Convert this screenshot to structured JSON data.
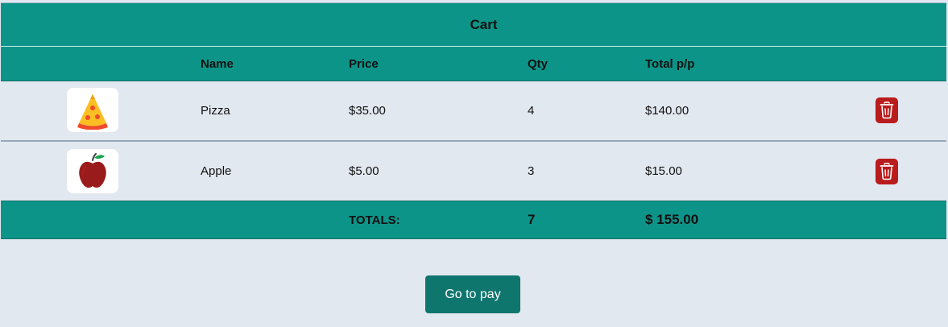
{
  "cart": {
    "title": "Cart",
    "columns": {
      "name": "Name",
      "price": "Price",
      "qty": "Qty",
      "total": "Total p/p"
    },
    "items": [
      {
        "name": "Pizza",
        "price": "$35.00",
        "qty": "4",
        "total": "$140.00",
        "icon": "pizza-icon"
      },
      {
        "name": "Apple",
        "price": "$5.00",
        "qty": "3",
        "total": "$15.00",
        "icon": "apple-icon"
      }
    ],
    "totals": {
      "label": "TOTALS:",
      "qty": "7",
      "amount": "$ 155.00"
    },
    "pay_button": "Go to pay"
  },
  "colors": {
    "teal": "#0d9488",
    "dark_teal": "#0f766e",
    "delete_red": "#b91c1c",
    "background": "#e2e8f0"
  }
}
